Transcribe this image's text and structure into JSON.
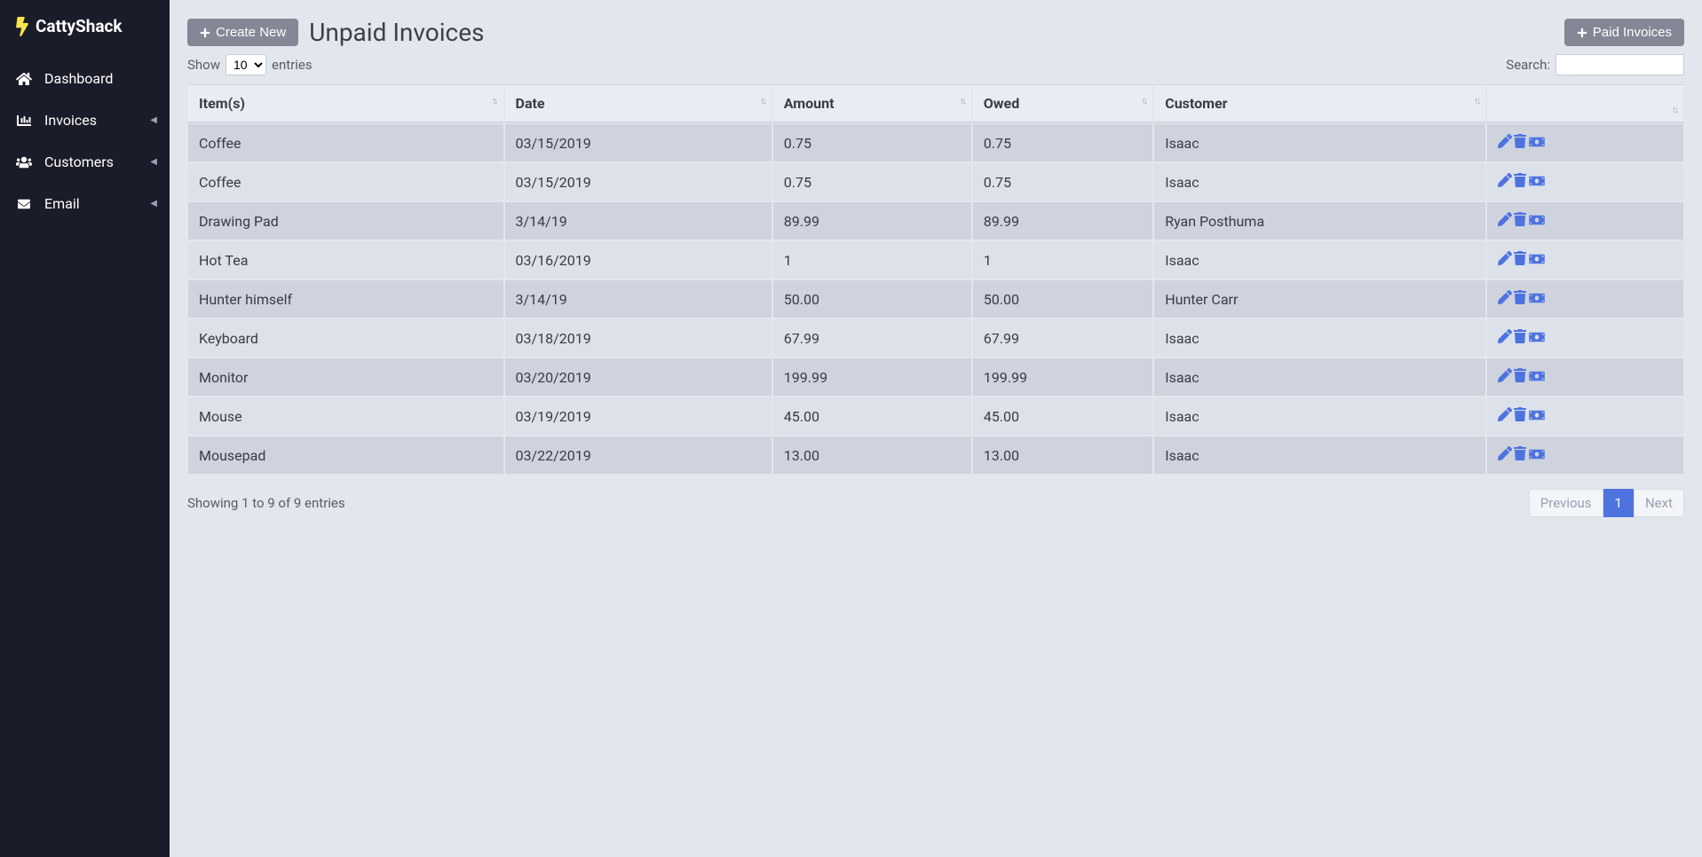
{
  "brand": {
    "name": "CattyShack"
  },
  "sidebar": {
    "items": [
      {
        "label": "Dashboard",
        "icon": "gauge",
        "expandable": false
      },
      {
        "label": "Invoices",
        "icon": "chart",
        "expandable": true
      },
      {
        "label": "Customers",
        "icon": "users",
        "expandable": true
      },
      {
        "label": "Email",
        "icon": "mail",
        "expandable": true
      }
    ]
  },
  "header": {
    "create_new": "Create New",
    "page_title": "Unpaid Invoices",
    "paid_invoices": "Paid Invoices"
  },
  "controls": {
    "show_prefix": "Show",
    "show_suffix": "entries",
    "show_value": "10",
    "search_label": "Search:"
  },
  "table": {
    "columns": [
      "Item(s)",
      "Date",
      "Amount",
      "Owed",
      "Customer",
      ""
    ],
    "rows": [
      {
        "item": "Coffee",
        "date": "03/15/2019",
        "amount": "0.75",
        "owed": "0.75",
        "customer": "Isaac"
      },
      {
        "item": "Coffee",
        "date": "03/15/2019",
        "amount": "0.75",
        "owed": "0.75",
        "customer": "Isaac"
      },
      {
        "item": "Drawing Pad",
        "date": "3/14/19",
        "amount": "89.99",
        "owed": "89.99",
        "customer": "Ryan Posthuma"
      },
      {
        "item": "Hot Tea",
        "date": "03/16/2019",
        "amount": "1",
        "owed": "1",
        "customer": "Isaac"
      },
      {
        "item": "Hunter himself",
        "date": "3/14/19",
        "amount": "50.00",
        "owed": "50.00",
        "customer": "Hunter Carr"
      },
      {
        "item": "Keyboard",
        "date": "03/18/2019",
        "amount": "67.99",
        "owed": "67.99",
        "customer": "Isaac"
      },
      {
        "item": "Monitor",
        "date": "03/20/2019",
        "amount": "199.99",
        "owed": "199.99",
        "customer": "Isaac"
      },
      {
        "item": "Mouse",
        "date": "03/19/2019",
        "amount": "45.00",
        "owed": "45.00",
        "customer": "Isaac"
      },
      {
        "item": "Mousepad",
        "date": "03/22/2019",
        "amount": "13.00",
        "owed": "13.00",
        "customer": "Isaac"
      }
    ]
  },
  "footer": {
    "info": "Showing 1 to 9 of 9 entries",
    "prev": "Previous",
    "page": "1",
    "next": "Next"
  }
}
